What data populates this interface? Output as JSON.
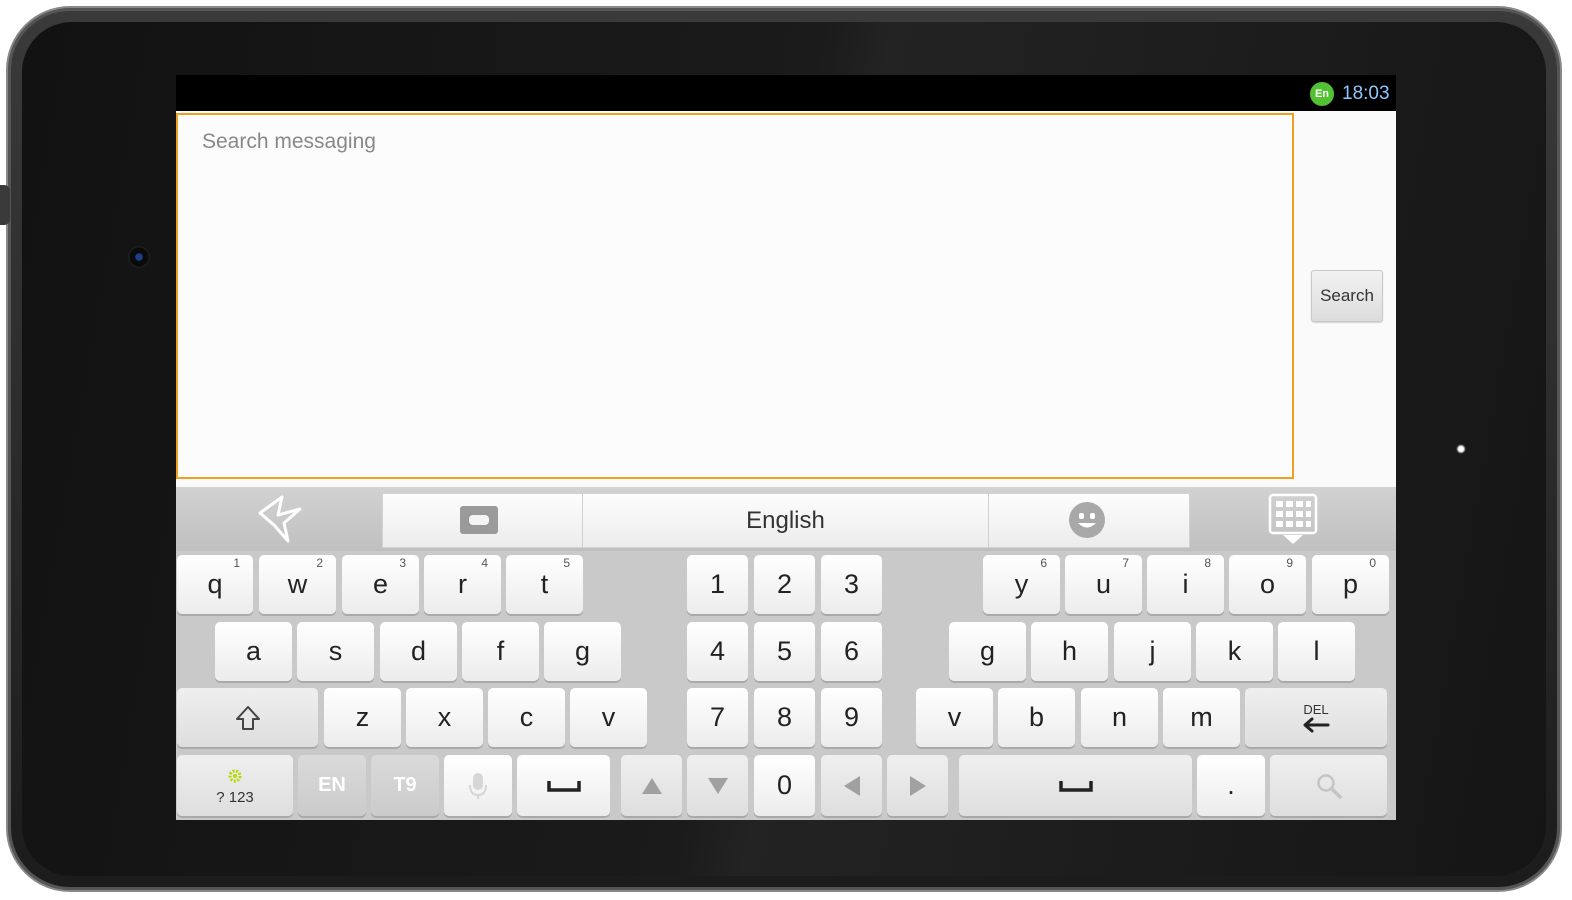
{
  "status_bar": {
    "lang_badge": "En",
    "time": "18:03"
  },
  "app": {
    "search_placeholder": "Search messaging",
    "search_button": "Search"
  },
  "keyboard": {
    "toolbar": {
      "language": "English",
      "icons": [
        "swype-logo-icon",
        "cursor-pad-icon",
        "emoji-icon",
        "keyboard-hide-icon"
      ]
    },
    "left_rows": [
      [
        {
          "k": "q",
          "n": "1"
        },
        {
          "k": "w",
          "n": "2"
        },
        {
          "k": "e",
          "n": "3"
        },
        {
          "k": "r",
          "n": "4"
        },
        {
          "k": "t",
          "n": "5"
        }
      ],
      [
        {
          "k": "a"
        },
        {
          "k": "s"
        },
        {
          "k": "d"
        },
        {
          "k": "f"
        },
        {
          "k": "g"
        }
      ],
      [
        {
          "k": "z"
        },
        {
          "k": "x"
        },
        {
          "k": "c"
        },
        {
          "k": "v"
        }
      ]
    ],
    "numpad": [
      "1",
      "2",
      "3",
      "4",
      "5",
      "6",
      "7",
      "8",
      "9",
      "0"
    ],
    "right_rows": [
      [
        {
          "k": "y",
          "n": "6"
        },
        {
          "k": "u",
          "n": "7"
        },
        {
          "k": "i",
          "n": "8"
        },
        {
          "k": "o",
          "n": "9"
        },
        {
          "k": "p",
          "n": "0"
        }
      ],
      [
        {
          "k": "g"
        },
        {
          "k": "h"
        },
        {
          "k": "j"
        },
        {
          "k": "k"
        },
        {
          "k": "l"
        }
      ],
      [
        {
          "k": "v"
        },
        {
          "k": "b"
        },
        {
          "k": "n"
        },
        {
          "k": "m"
        }
      ]
    ],
    "special": {
      "symbols": "? 123",
      "lang": "EN",
      "t9": "T9",
      "del": "DEL",
      "period": "."
    }
  },
  "colors": {
    "focus_border": "#f0a020",
    "status_time": "#8ec7ff",
    "lang_badge": "#52c234"
  }
}
